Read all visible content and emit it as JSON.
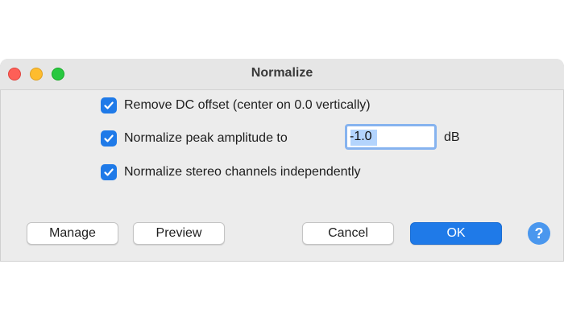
{
  "window": {
    "title": "Normalize",
    "traffic_lights": [
      "close",
      "minimize",
      "zoom"
    ]
  },
  "options": {
    "remove_dc": {
      "label": "Remove DC offset (center on 0.0 vertically)",
      "checked": true
    },
    "normalize_peak": {
      "label": "Normalize peak amplitude to",
      "checked": true,
      "value": "-1.0",
      "unit": "dB"
    },
    "stereo_independent": {
      "label": "Normalize stereo channels independently",
      "checked": true
    }
  },
  "buttons": {
    "manage": "Manage",
    "preview": "Preview",
    "cancel": "Cancel",
    "ok": "OK",
    "help": "?"
  },
  "colors": {
    "accent": "#1f7ae8",
    "close": "#fe5f57",
    "minimize": "#febc2e",
    "zoom": "#28c840",
    "help": "#4a97ee"
  }
}
